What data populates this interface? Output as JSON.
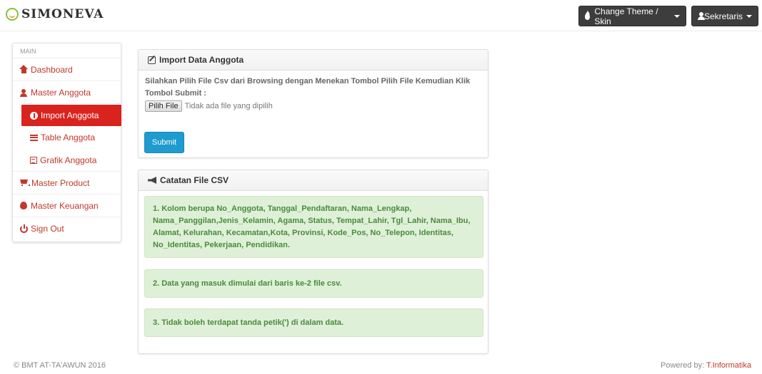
{
  "brand": {
    "name": "SIMONEVA"
  },
  "header": {
    "theme_button": "Change Theme / Skin",
    "user_button": "Sekretaris"
  },
  "sidebar": {
    "section_label": "MAIN",
    "items": [
      {
        "label": "Dashboard",
        "icon": "home-icon"
      },
      {
        "label": "Master Anggota",
        "icon": "user-icon"
      },
      {
        "label": "Import Anggota",
        "icon": "info-circle-icon",
        "active": true
      },
      {
        "label": "Table Anggota",
        "icon": "list-icon"
      },
      {
        "label": "Grafik Anggota",
        "icon": "chart-icon"
      },
      {
        "label": "Master Product",
        "icon": "cart-icon"
      },
      {
        "label": "Master Keuangan",
        "icon": "fire-icon"
      },
      {
        "label": "Sign Out",
        "icon": "power-icon"
      }
    ]
  },
  "import_panel": {
    "title": "Import Data Anggota",
    "instruction": "Silahkan Pilih File Csv dari Browsing dengan Menekan Tombol Pilih File Kemudian Klik Tombol Submit :",
    "file_button": "Pilih File",
    "file_status": "Tidak ada file yang dipilih",
    "submit_label": "Submit"
  },
  "notes_panel": {
    "title": "Catatan File CSV",
    "notes": [
      "1. Kolom berupa No_Anggota, Tanggal_Pendaftaran, Nama_Lengkap, Nama_Panggilan,Jenis_Kelamin, Agama, Status, Tempat_Lahir, Tgl_Lahir, Nama_Ibu, Alamat, Kelurahan, Kecamatan,Kota, Provinsi, Kode_Pos, No_Telepon, Identitas, No_Identitas, Pekerjaan, Pendidikan.",
      "2. Data yang masuk dimulai dari baris ke-2 file csv.",
      "3. Tidak boleh terdapat tanda petik(') di dalam data."
    ]
  },
  "footer": {
    "copyright": "© BMT AT-TA'AWUN 2016",
    "powered_prefix": "Powered by: ",
    "powered_link": "T.Informatika"
  },
  "colors": {
    "accent_red": "#d9231f",
    "submit_blue": "#1f9bcf",
    "note_green_bg": "#dff0d8",
    "note_green_text": "#4a8a3c"
  }
}
